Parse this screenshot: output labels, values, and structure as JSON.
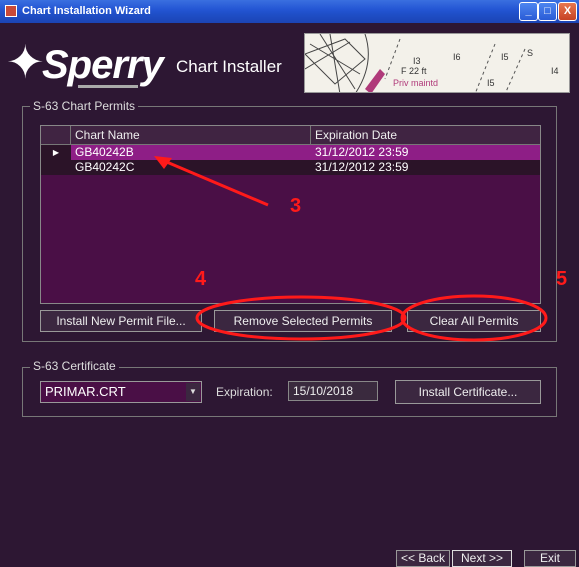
{
  "window": {
    "title": "Chart Installation Wizard",
    "buttons": {
      "minimize": "_",
      "maximize": "□",
      "close": "X"
    }
  },
  "header": {
    "logo_text": "Sperry",
    "title": "Chart Installer",
    "map_labels": [
      "I3",
      "I6",
      "I5",
      "S",
      "I4",
      "F 22 ft",
      "Priv maintd",
      "I5"
    ]
  },
  "permits": {
    "group_title": "S-63 Chart Permits",
    "columns": [
      "Chart Name",
      "Expiration Date"
    ],
    "rows": [
      {
        "chart_name": "GB40242B",
        "expiration": "31/12/2012 23:59",
        "selected": true
      },
      {
        "chart_name": "GB40242C",
        "expiration": "31/12/2012 23:59",
        "selected": false
      }
    ],
    "install_button": "Install New Permit File...",
    "remove_button": "Remove Selected Permits",
    "clear_button": "Clear All Permits"
  },
  "certificate": {
    "group_title": "S-63 Certificate",
    "selected_cert": "PRIMAR.CRT",
    "expiration_label": "Expiration:",
    "expiration_value": "15/10/2018",
    "install_button": "Install Certificate..."
  },
  "footer": {
    "back_button": "<< Back",
    "next_button": "Next >>",
    "exit_button": "Exit"
  },
  "annotations": {
    "three": "3",
    "four": "4",
    "five": "5"
  },
  "colors": {
    "accent": "#ff1a1a",
    "selected_row": "#8e1e86",
    "background": "#2d1733"
  }
}
